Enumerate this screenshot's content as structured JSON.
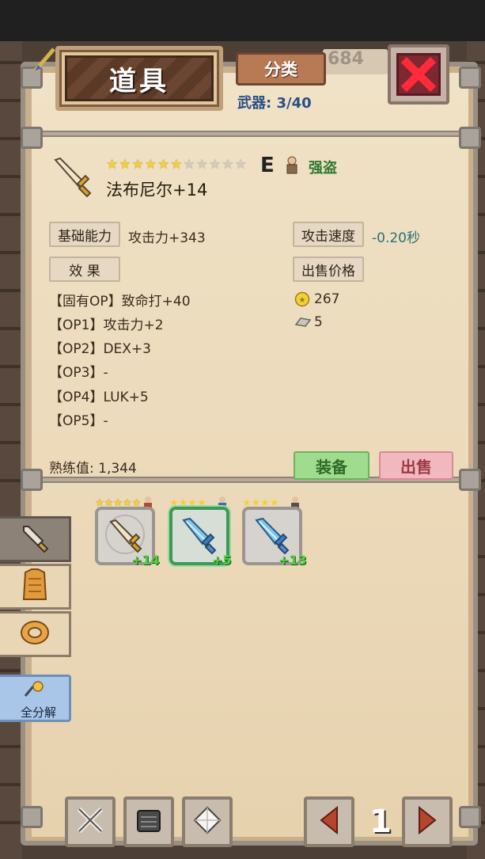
{
  "header": {
    "title": "道具",
    "category_label": "分类",
    "ghost_count": "684",
    "weapons_label": "武器:",
    "weapons_count": "3/40"
  },
  "item": {
    "grade_letter": "E",
    "class_name": "强盗",
    "name": "法布尼尔+14",
    "star_filled": 6,
    "star_total": 11
  },
  "stats": {
    "base_label": "基础能力",
    "base_value": "攻击力+343",
    "speed_label": "攻击速度",
    "speed_value": "-0.20秒",
    "effect_label": "效 果",
    "sell_price_label": "出售价格",
    "effects": [
      "【固有OP】致命打+40",
      "【OP1】攻击力+2",
      "【OP2】DEX+3",
      "【OP3】-",
      "【OP4】LUK+5",
      "【OP5】-"
    ],
    "gold_price": "267",
    "material_price": "5",
    "proficiency": "熟练值: 1,344"
  },
  "actions": {
    "equip": "装备",
    "sell": "出售"
  },
  "inventory": [
    {
      "plus": "+14",
      "stars": "★★★★★",
      "selected": false,
      "weapon": "golden-sword"
    },
    {
      "plus": "+5",
      "stars": "★★★★",
      "selected": true,
      "weapon": "ice-sword"
    },
    {
      "plus": "+13",
      "stars": "★★★★",
      "selected": false,
      "weapon": "ice-sword"
    }
  ],
  "sidebar": {
    "disassemble_label": "全分解"
  },
  "pager": {
    "page": "1"
  },
  "colors": {
    "gold": "#f3cf3c",
    "green_plus": "#4fd13a",
    "blue_text": "#2b4f86",
    "speed_text": "#2a6f78"
  }
}
